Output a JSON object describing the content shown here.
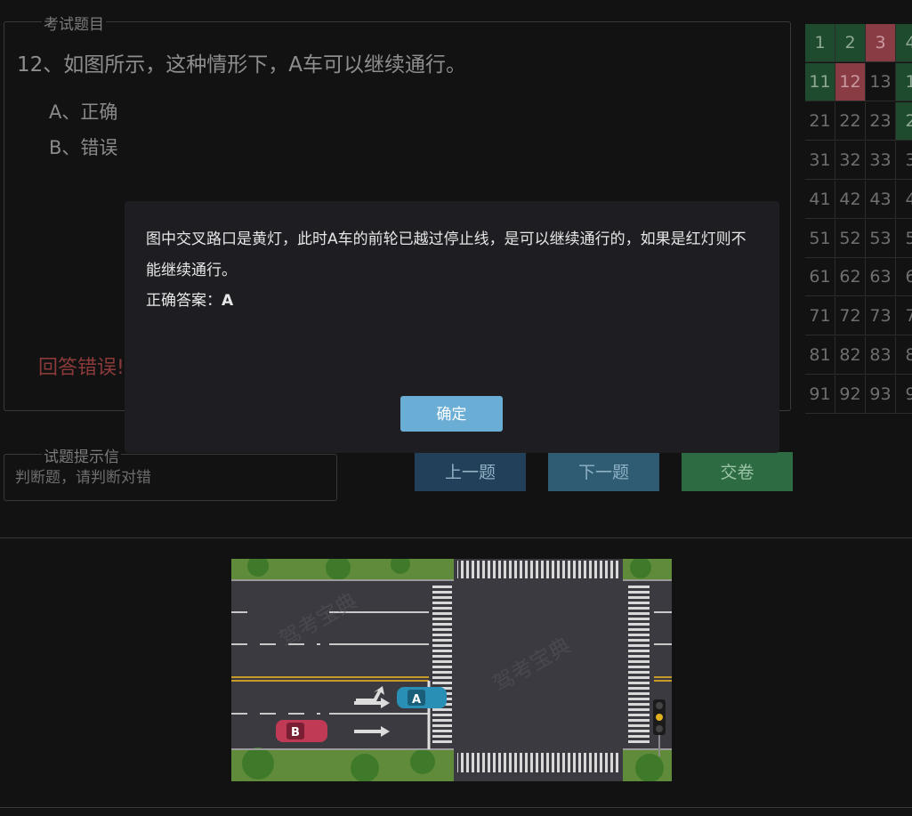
{
  "question": {
    "legend": "考试题目",
    "title": "12、如图所示，这种情形下，A车可以继续通行。",
    "options": [
      "A、正确",
      "B、错误"
    ],
    "result": "回答错误!"
  },
  "hint": {
    "legend": "试题提示信",
    "text": "判断题，请判断对错"
  },
  "nav": {
    "prev": "上一题",
    "next": "下一题",
    "submit": "交卷"
  },
  "grid": {
    "rows": [
      [
        "1",
        "2",
        "3",
        "4"
      ],
      [
        "11",
        "12",
        "13",
        "1"
      ],
      [
        "21",
        "22",
        "23",
        "2"
      ],
      [
        "31",
        "32",
        "33",
        "3"
      ],
      [
        "41",
        "42",
        "43",
        "4"
      ],
      [
        "51",
        "52",
        "53",
        "5"
      ],
      [
        "61",
        "62",
        "63",
        "6"
      ],
      [
        "71",
        "72",
        "73",
        "7"
      ],
      [
        "81",
        "82",
        "83",
        "8"
      ],
      [
        "91",
        "92",
        "93",
        "9"
      ]
    ],
    "correct": [
      "1",
      "2",
      "11"
    ],
    "wrong": [
      "3",
      "12"
    ]
  },
  "scene": {
    "car_a": "A",
    "car_b": "B",
    "watermark": "驾考宝典"
  },
  "modal": {
    "explanation": "图中交叉路口是黄灯，此时A车的前轮已越过停止线，是可以继续通行的，如果是红灯则不能继续通行。",
    "answer_label": "正确答案：",
    "answer_value": "A",
    "confirm": "确定"
  },
  "colors": {
    "correct": "#1e4a2d",
    "wrong": "#8a3c45",
    "confirm": "#6aaed6"
  }
}
